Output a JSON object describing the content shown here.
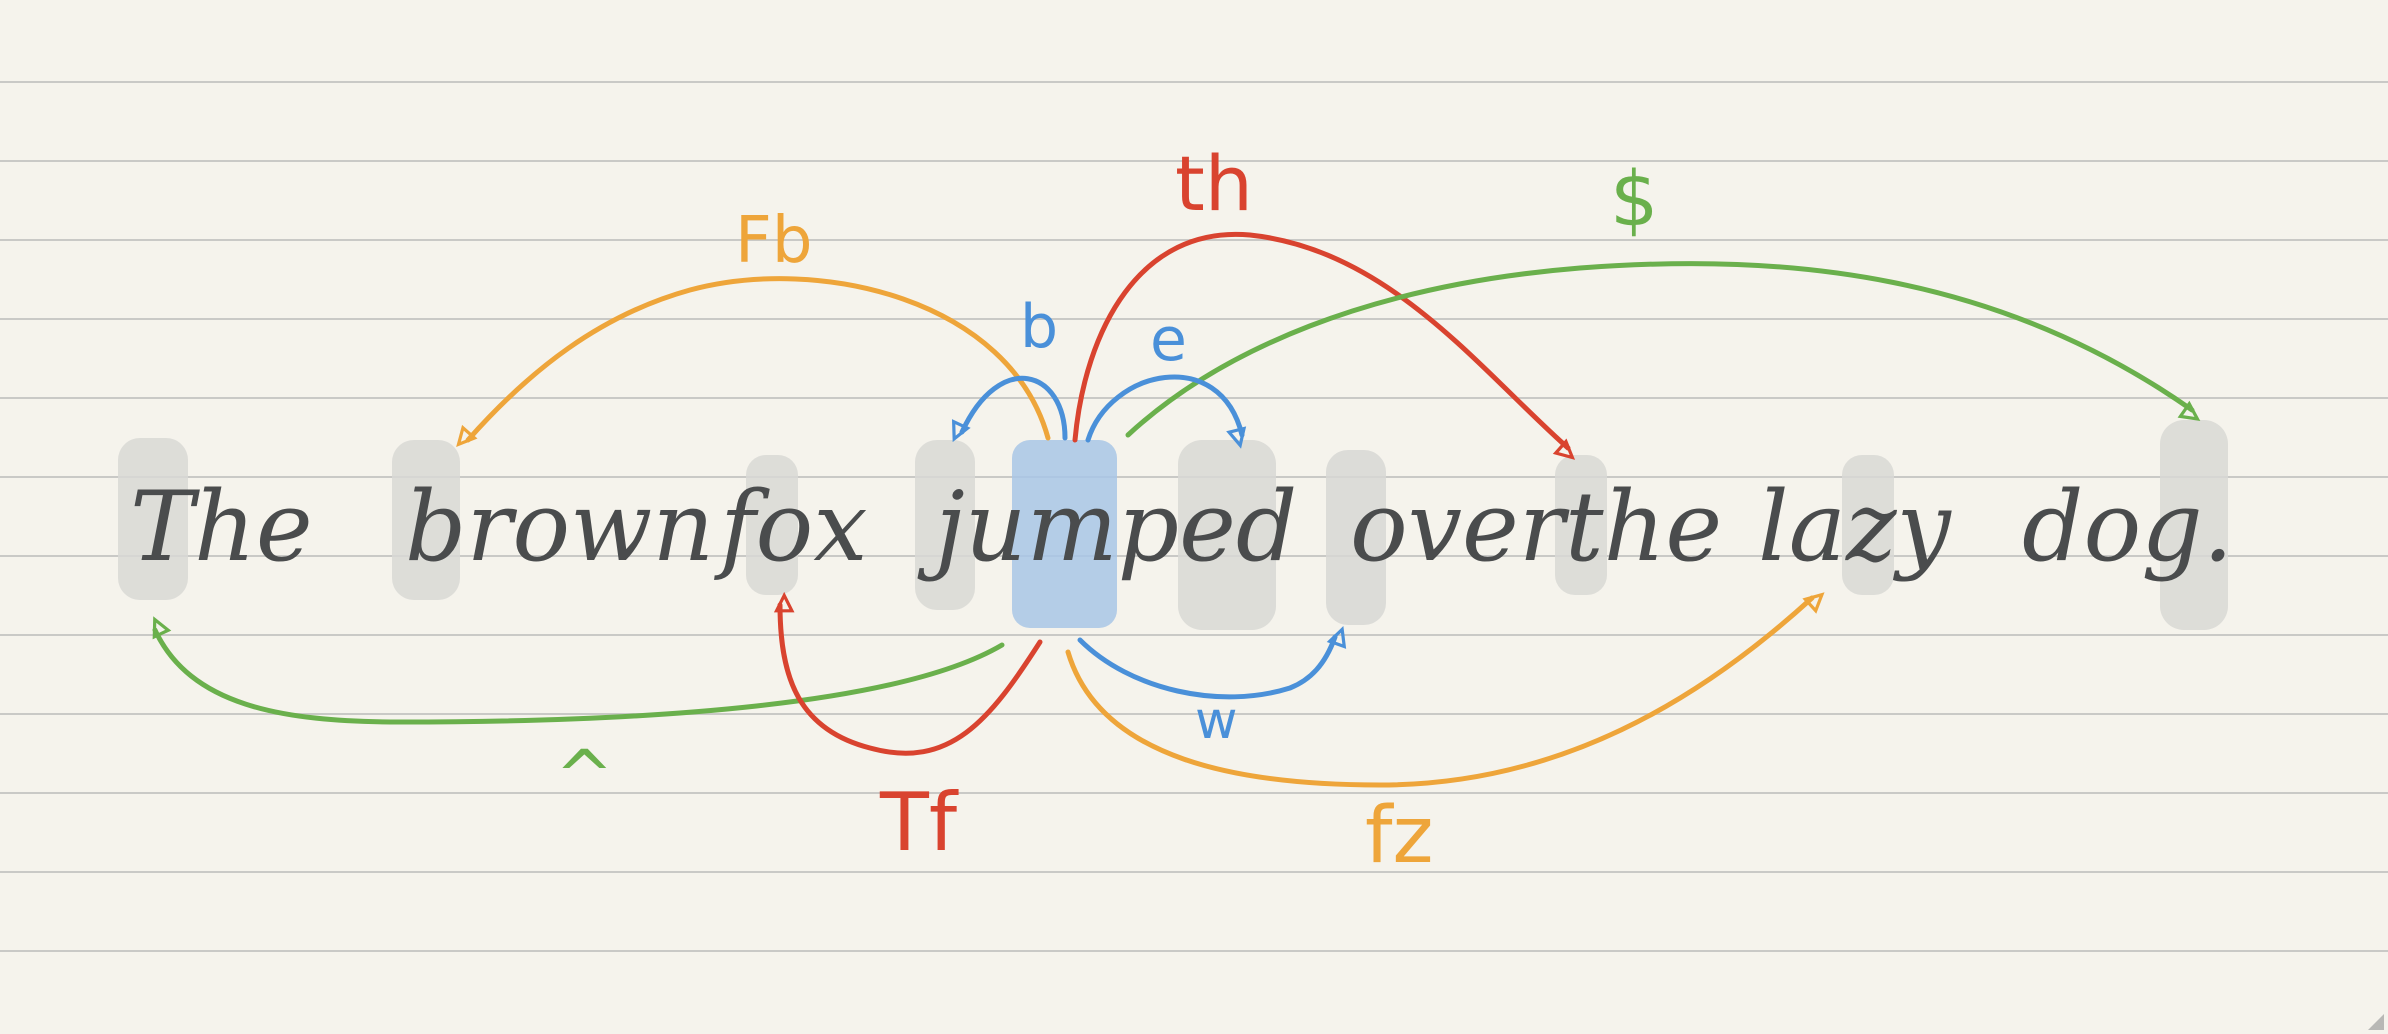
{
  "colors": {
    "paper": "#f5f3ec",
    "rule": "#c9c9c6",
    "ink": "#4a4c4d",
    "stop": "#d8d8d5",
    "cursor": "#a8c6e6",
    "orange": "#eea53a",
    "red": "#d9432f",
    "green": "#6ab04c",
    "blue": "#4a90d9"
  },
  "sentence": {
    "words": [
      "The",
      "brown",
      "fox",
      "jumped",
      "over",
      "the",
      "lazy",
      "dog."
    ]
  },
  "motions": {
    "Fb": "Fb",
    "th": "th",
    "dollar": "$",
    "b": "b",
    "e": "e",
    "caret": "^",
    "Tf": "Tf",
    "w": "w",
    "fz": "fz"
  },
  "icons": {
    "corner": "resize-corner-icon"
  }
}
